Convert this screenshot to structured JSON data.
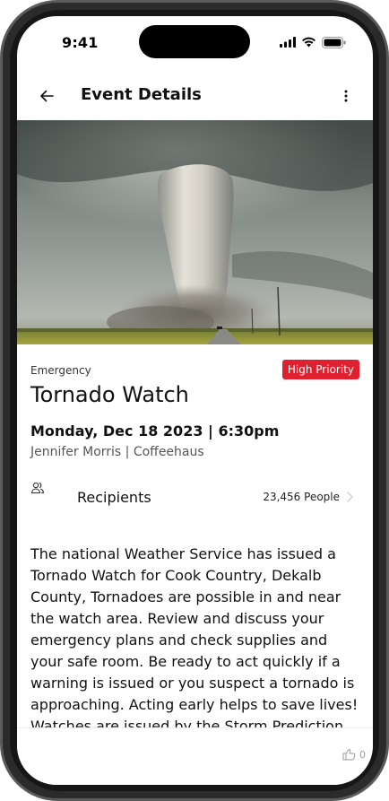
{
  "status_bar": {
    "time": "9:41"
  },
  "header": {
    "title": "Event Details"
  },
  "event": {
    "category": "Emergency",
    "priority": "High Priority",
    "title": "Tornado Watch",
    "datetime": "Monday, Dec 18 2023 | 6:30pm",
    "host": "Jennifer Morris | Coffeehaus",
    "description": "The national Weather Service has issued a Tornado Watch for Cook Country, Dekalb County, Tornadoes are possible in and near the watch area. Review and discuss your emergency plans and check supplies and your safe room. Be ready to act quickly if a warning is issued or you suspect a tornado is approaching. Acting early helps to save lives! Watches are issued by the Storm Prediction Center for counties where"
  },
  "recipients": {
    "label": "Recipients",
    "count": "23,456 People"
  },
  "footer": {
    "like_count": "0"
  },
  "colors": {
    "priority_badge": "#e0202f",
    "text": "#111111"
  },
  "icons": {
    "back": "arrow-left-icon",
    "more": "more-vertical-icon",
    "recipients": "users-icon",
    "chevron": "chevron-right-icon",
    "like": "thumbs-up-icon"
  }
}
